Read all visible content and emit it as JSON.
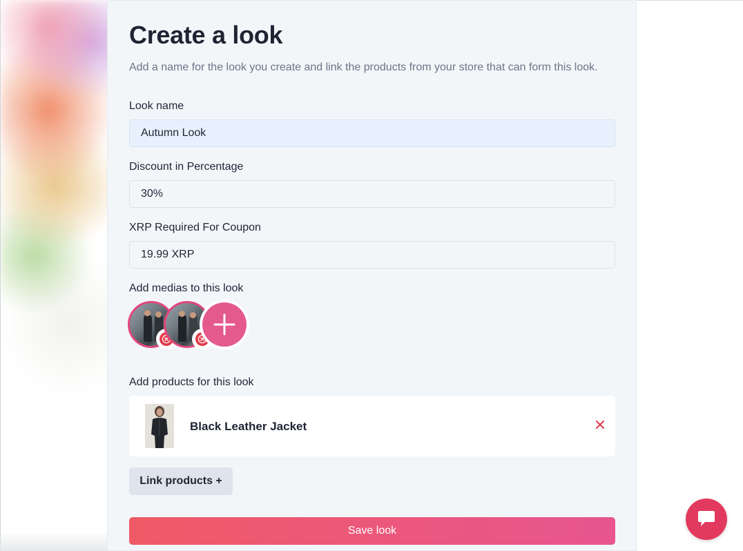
{
  "header": {
    "title": "Create a look",
    "subtitle": "Add a name for the look you create and link the products from your store that can form this look."
  },
  "form": {
    "look_name": {
      "label": "Look name",
      "value": "Autumn Look"
    },
    "discount": {
      "label": "Discount in Percentage",
      "value": "30%"
    },
    "xrp_required": {
      "label": "XRP Required For Coupon",
      "value": "19.99 XRP"
    },
    "medias": {
      "label": "Add medias to this look",
      "items": [
        {
          "name": "media-1",
          "remove_icon": "close-circle-icon"
        },
        {
          "name": "media-2",
          "remove_icon": "close-circle-icon"
        }
      ],
      "add_icon": "plus-icon"
    },
    "products": {
      "label": "Add products for this look",
      "items": [
        {
          "name": "Black Leather Jacket",
          "remove_icon": "close-icon"
        }
      ],
      "link_button": "Link products +"
    },
    "save_button": "Save look"
  },
  "chat": {
    "icon": "chat-bubble-icon"
  },
  "colors": {
    "accent": "#e23a5e",
    "save_gradient_start": "#ef5a66",
    "save_gradient_end": "#e8558f",
    "media_border": "#e0467c",
    "panel_bg": "#f3f6f9",
    "active_input_bg": "#e8f0fd"
  }
}
